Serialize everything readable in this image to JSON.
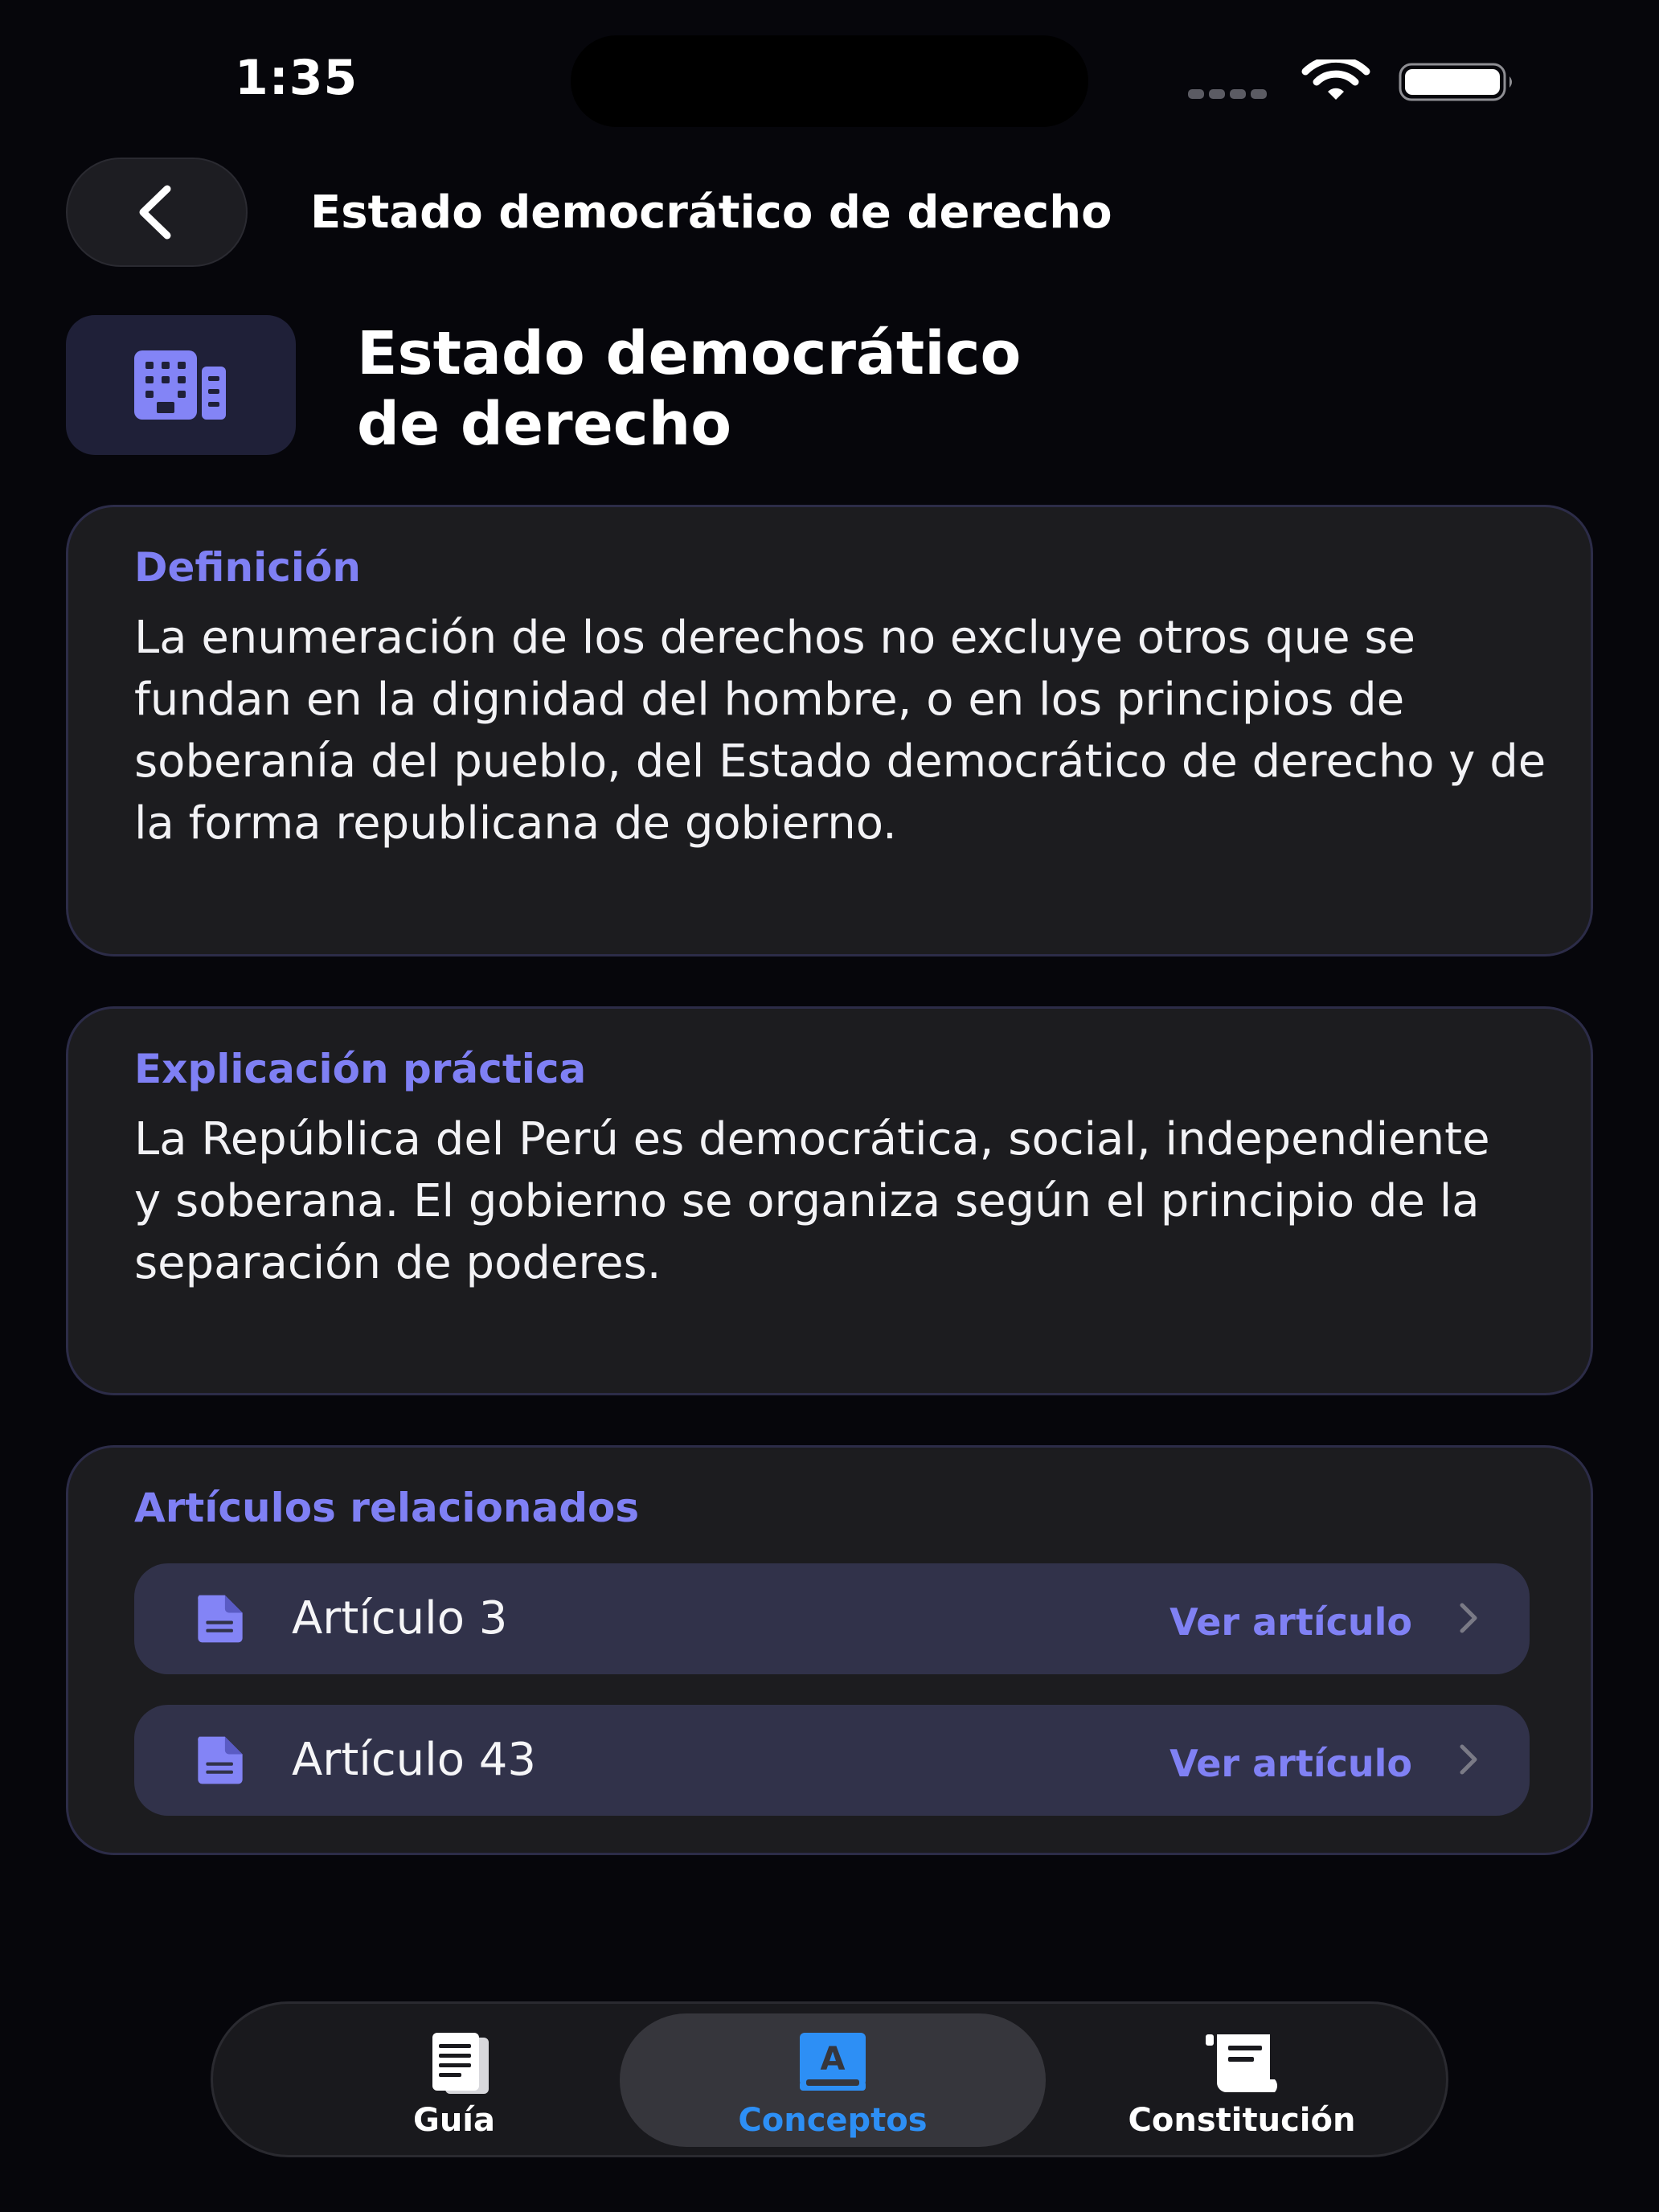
{
  "status_bar": {
    "time": "1:35"
  },
  "nav": {
    "back_icon": "chevron-left-icon",
    "title": "Estado democrático de derecho"
  },
  "header": {
    "icon": "building-icon",
    "title_line1": "Estado democrático",
    "title_line2": "de derecho"
  },
  "definition": {
    "heading": "Definición",
    "text": "La enumeración de los derechos no excluye otros que se fundan en la dignidad del hombre, o en los principios de soberanía del pueblo, del Estado democrático de derecho y de la forma republicana de gobierno."
  },
  "explanation": {
    "heading": "Explicación práctica",
    "text": "La República del Perú es democrática, social, independiente y soberana. El gobierno se organiza según el principio de la separación de poderes."
  },
  "related": {
    "heading": "Artículos relacionados",
    "items": [
      {
        "label": "Artículo 3",
        "link": "Ver artículo",
        "icon": "document-icon"
      },
      {
        "label": "Artículo 43",
        "link": "Ver artículo",
        "icon": "document-icon"
      }
    ]
  },
  "tab_bar": {
    "tabs": [
      {
        "label": "Guía",
        "icon": "book-pages-icon",
        "selected": false
      },
      {
        "label": "Conceptos",
        "icon": "dictionary-icon",
        "selected": true
      },
      {
        "label": "Constitución",
        "icon": "scroll-icon",
        "selected": false
      }
    ]
  },
  "colors": {
    "background": "#06060b",
    "accent": "#7f80f4",
    "card": "#1c1c1f",
    "row": "#31324a",
    "tab_active": "#2d8ff5"
  }
}
